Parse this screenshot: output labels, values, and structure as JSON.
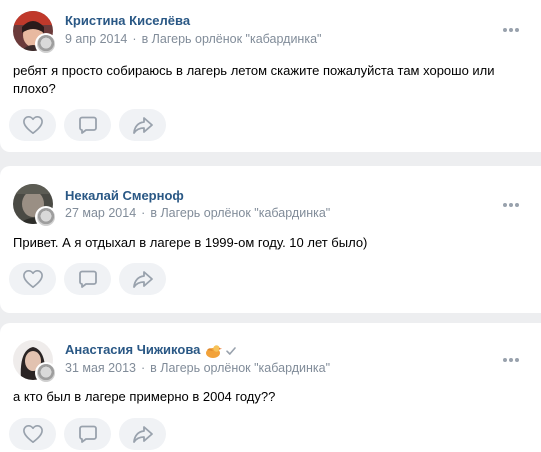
{
  "posts": [
    {
      "author": "Кристина Киселёва",
      "date": "9 апр 2014",
      "place": "в Лагерь орлёнок \"кабардинка\"",
      "text": "ребят я просто собираюсь в лагерь летом скажите пожалуйста там хорошо или плохо?"
    },
    {
      "author": "Некалай Смернoф",
      "date": "27 мар 2014",
      "place": "в Лагерь орлёнок \"кабардинка\"",
      "text": "Привет. А я отдыхал в лагере в 1999-ом году. 10 лет было)"
    },
    {
      "author": "Анастасия Чижикова",
      "date": "31 мая 2013",
      "place": "в Лагерь орлёнок \"кабардинка\"",
      "text": "а кто был в лагере примерно в 2004 году??"
    }
  ],
  "separator": "·",
  "icons": {
    "like": "heart-icon",
    "comment": "comment-icon",
    "share": "share-icon",
    "more": "more-dots-icon",
    "group_badge": "group-avatar-badge",
    "emoji_status": "bird-emoji-status-icon",
    "verified": "check-icon"
  },
  "colors": {
    "author": "#2a5885",
    "meta": "#818c99",
    "action_bg": "#f0f2f5",
    "action_icon": "#99a2ad",
    "page_bg": "#edeef0"
  }
}
